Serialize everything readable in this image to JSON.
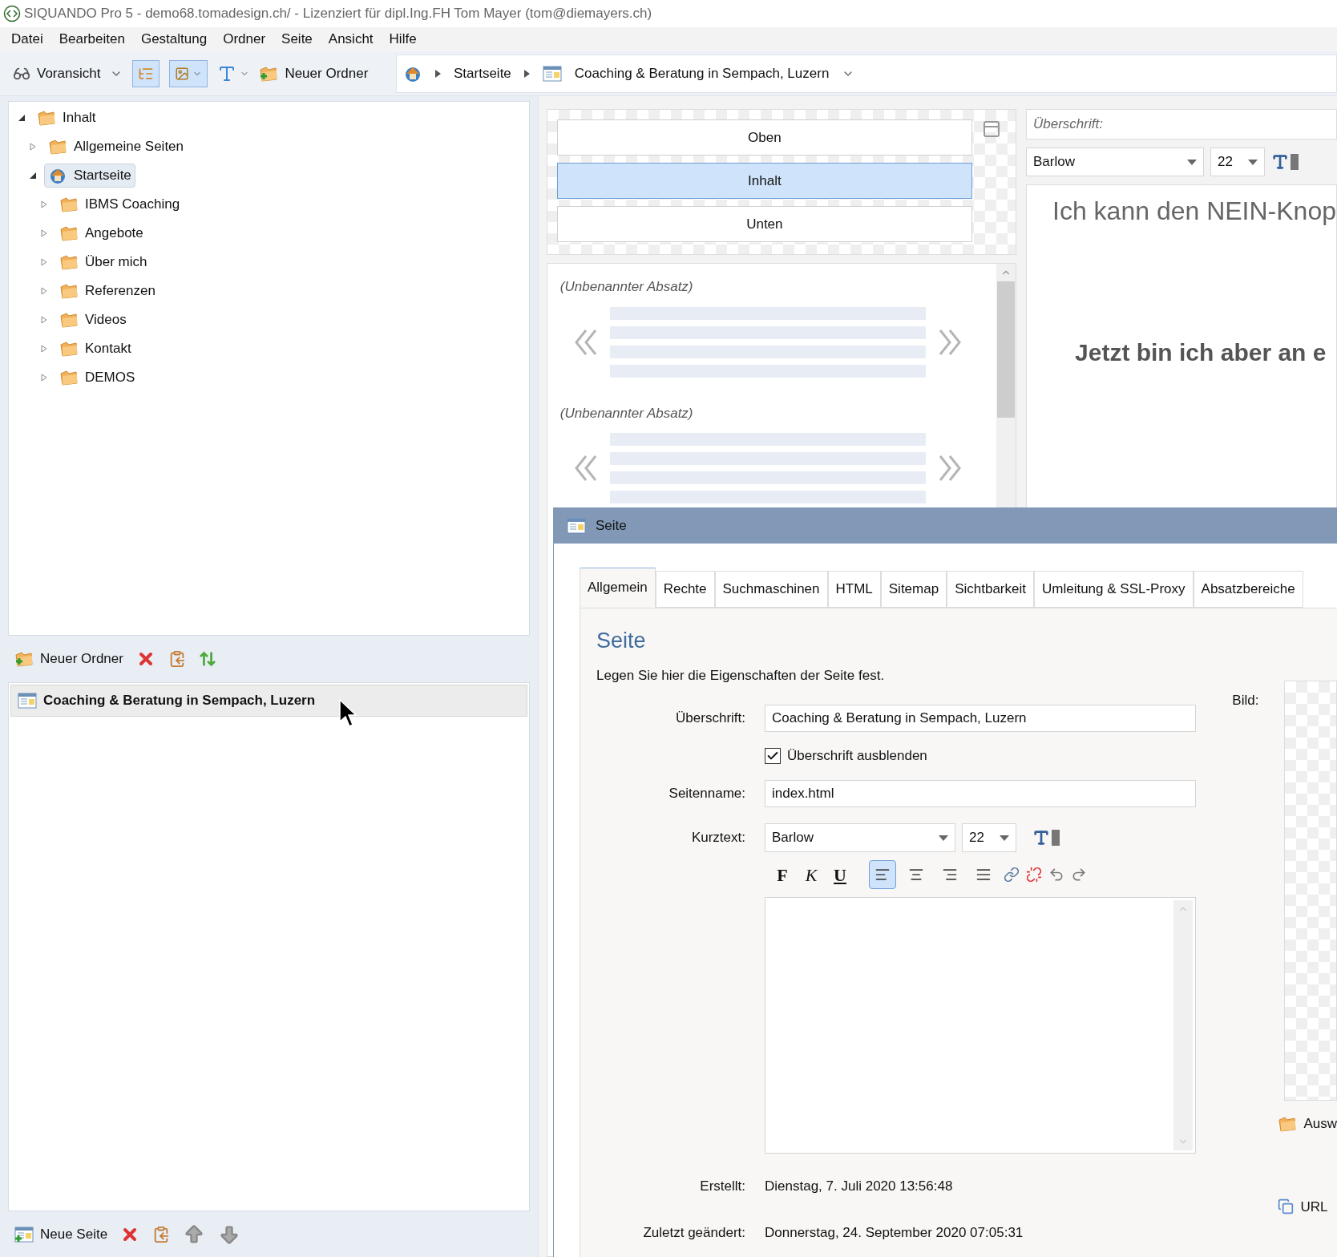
{
  "window": {
    "title": "SIQUANDO Pro 5 - demo68.tomadesign.ch/ - Lizenziert für dipl.Ing.FH Tom Mayer (tom@diemayers.ch)"
  },
  "menu": [
    "Datei",
    "Bearbeiten",
    "Gestaltung",
    "Ordner",
    "Seite",
    "Ansicht",
    "Hilfe"
  ],
  "toolbar": {
    "preview_label": "Voransicht",
    "new_folder_label": "Neuer Ordner",
    "breadcrumb": [
      "Startseite",
      "Coaching & Beratung in Sempach, Luzern"
    ]
  },
  "tree": [
    {
      "label": "Inhalt",
      "kind": "root",
      "expanded": true,
      "selected": false,
      "children": [
        {
          "label": "Allgemeine Seiten",
          "kind": "folder",
          "expanded": false,
          "selected": false
        },
        {
          "label": "Startseite",
          "kind": "home",
          "expanded": true,
          "selected": true,
          "children": [
            {
              "label": "IBMS Coaching",
              "kind": "folder",
              "expanded": false,
              "selected": false
            },
            {
              "label": "Angebote",
              "kind": "folder",
              "expanded": false,
              "selected": false
            },
            {
              "label": "Über mich",
              "kind": "folder",
              "expanded": false,
              "selected": false
            },
            {
              "label": "Referenzen",
              "kind": "folder",
              "expanded": false,
              "selected": false
            },
            {
              "label": "Videos",
              "kind": "folder",
              "expanded": false,
              "selected": false
            },
            {
              "label": "Kontakt",
              "kind": "folder",
              "expanded": false,
              "selected": false
            },
            {
              "label": "DEMOS",
              "kind": "folder",
              "expanded": false,
              "selected": false
            }
          ]
        }
      ]
    }
  ],
  "folder_toolbar": {
    "new_label": "Neuer Ordner"
  },
  "pages": [
    {
      "label": "Coaching & Beratung in Sempach, Luzern",
      "selected": true
    }
  ],
  "page_toolbar": {
    "new_label": "Neue Seite"
  },
  "areas": [
    {
      "label": "Oben",
      "selected": false
    },
    {
      "label": "Inhalt",
      "selected": true
    },
    {
      "label": "Unten",
      "selected": false
    }
  ],
  "paragraphs": [
    {
      "title": "(Unbenannter Absatz)"
    },
    {
      "title": "(Unbenannter Absatz)"
    }
  ],
  "preview": {
    "heading_placeholder": "Überschrift:",
    "font": "Barlow",
    "size": "22",
    "line_1": "Ich kann den NEIN-Knop",
    "line_2": "Jetzt bin ich aber an e"
  },
  "dialog": {
    "title": "Seite",
    "tabs": [
      {
        "label": "Allgemein",
        "selected": true
      },
      {
        "label": "Rechte",
        "selected": false
      },
      {
        "label": "Suchmaschinen",
        "selected": false
      },
      {
        "label": "HTML",
        "selected": false
      },
      {
        "label": "Sitemap",
        "selected": false
      },
      {
        "label": "Sichtbarkeit",
        "selected": false
      },
      {
        "label": "Umleitung & SSL-Proxy",
        "selected": false
      },
      {
        "label": "Absatzbereiche",
        "selected": false
      }
    ],
    "heading": "Seite",
    "description": "Legen Sie hier die Eigenschaften der Seite fest.",
    "heading_label": "Überschrift:",
    "heading_value": "Coaching & Beratung in Sempach, Luzern",
    "hide_heading": {
      "label": "Überschrift ausblenden",
      "checked": true
    },
    "page_name_label": "Seitenname:",
    "page_name_value": "index.html",
    "short_text_label": "Kurztext:",
    "font": "Barlow",
    "size": "22",
    "format_buttons": [
      {
        "kind": "bold",
        "label": "F"
      },
      {
        "kind": "italic",
        "label": "K"
      },
      {
        "kind": "underline",
        "label": "U"
      }
    ],
    "align_buttons": [
      {
        "kind": "left",
        "selected": true
      },
      {
        "kind": "center",
        "selected": false
      },
      {
        "kind": "right",
        "selected": false
      },
      {
        "kind": "justify",
        "selected": false
      }
    ],
    "image_label": "Bild:",
    "image_select_label": "Ausw",
    "created_label": "Erstellt:",
    "created_value": "Dienstag, 7. Juli 2020 13:56:48",
    "modified_label": "Zuletzt geändert:",
    "modified_value": "Donnerstag, 24. September 2020 07:05:31",
    "url_label": "URL"
  }
}
